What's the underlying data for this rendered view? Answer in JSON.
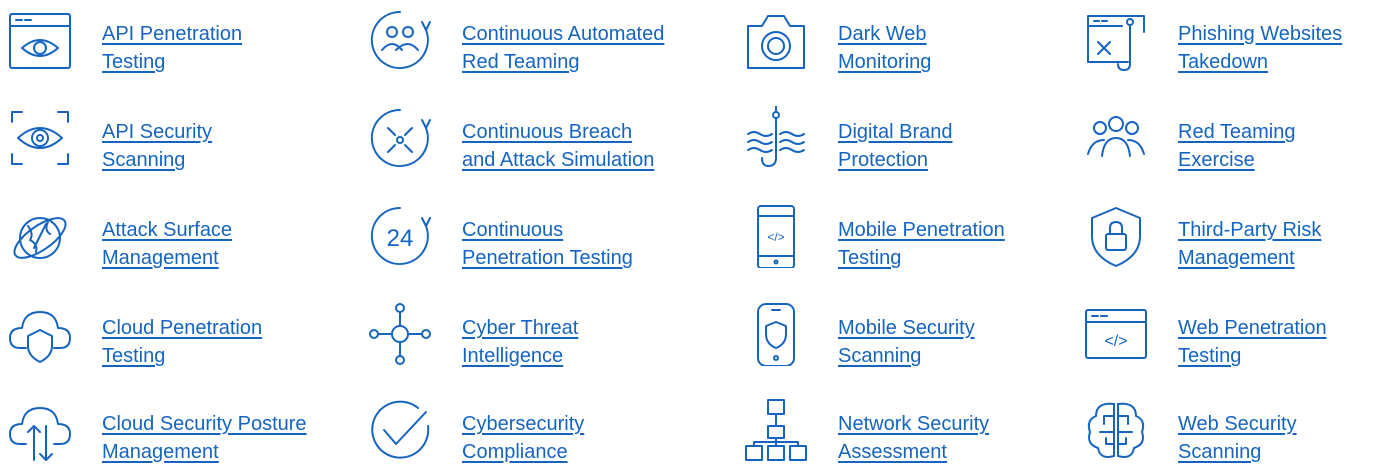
{
  "services": [
    {
      "icon": "eye-window-icon",
      "line1": "API Penetration",
      "line2": "Testing"
    },
    {
      "icon": "team-cycle-icon",
      "line1": "Continuous Automated",
      "line2": "Red Teaming"
    },
    {
      "icon": "camera-icon",
      "line1": "Dark Web",
      "line2": "Monitoring"
    },
    {
      "icon": "phishing-window-hook-icon",
      "line1": "Phishing Websites",
      "line2": "Takedown"
    },
    {
      "icon": "eye-scan-icon",
      "line1": "API Security",
      "line2": "Scanning"
    },
    {
      "icon": "breach-cycle-icon",
      "line1": "Continuous Breach",
      "line2": "and Attack Simulation"
    },
    {
      "icon": "hook-waves-icon",
      "line1": "Digital Brand",
      "line2": "Protection"
    },
    {
      "icon": "team-icon",
      "line1": "Red Teaming",
      "line2": "Exercise"
    },
    {
      "icon": "globe-orbit-icon",
      "line1": "Attack Surface",
      "line2": "Management"
    },
    {
      "icon": "clock-24-icon",
      "line1": "Continuous",
      "line2": "Penetration Testing"
    },
    {
      "icon": "mobile-code-icon",
      "line1": "Mobile Penetration",
      "line2": "Testing"
    },
    {
      "icon": "shield-lock-icon",
      "line1": "Third-Party Risk",
      "line2": "Management"
    },
    {
      "icon": "cloud-shield-icon",
      "line1": "Cloud Penetration",
      "line2": "Testing"
    },
    {
      "icon": "network-node-icon",
      "line1": "Cyber Threat",
      "line2": "Intelligence"
    },
    {
      "icon": "mobile-shield-icon",
      "line1": "Mobile Security",
      "line2": "Scanning"
    },
    {
      "icon": "code-window-icon",
      "line1": "Web Penetration",
      "line2": "Testing"
    },
    {
      "icon": "cloud-arrows-icon",
      "line1": "Cloud Security Posture",
      "line2": "Management"
    },
    {
      "icon": "check-circle-icon",
      "line1": "Cybersecurity",
      "line2": "Compliance"
    },
    {
      "icon": "network-hierarchy-icon",
      "line1": "Network Security",
      "line2": "Assessment"
    },
    {
      "icon": "circuit-brain-icon",
      "line1": "Web Security",
      "line2": "Scanning"
    }
  ],
  "icon_text": {
    "clock": "24",
    "code": "</>"
  },
  "colors": {
    "link": "#1565c0",
    "background": "#ffffff"
  }
}
